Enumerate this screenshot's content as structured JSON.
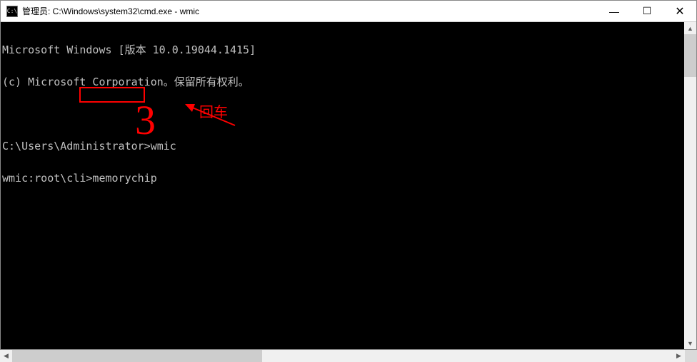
{
  "window": {
    "icon_text": "C:\\",
    "title": "管理员: C:\\Windows\\system32\\cmd.exe - wmic"
  },
  "controls": {
    "minimize": "—",
    "maximize": "☐",
    "close": "✕"
  },
  "terminal": {
    "line1": "Microsoft Windows [版本 10.0.19044.1415]",
    "line2": "(c) Microsoft Corporation。保留所有权利。",
    "line3": "",
    "line4": "C:\\Users\\Administrator>wmic",
    "line5": "wmic:root\\cli>memorychip"
  },
  "annotation": {
    "boxed_command": "memorychip",
    "label": "回车",
    "number": "3"
  }
}
